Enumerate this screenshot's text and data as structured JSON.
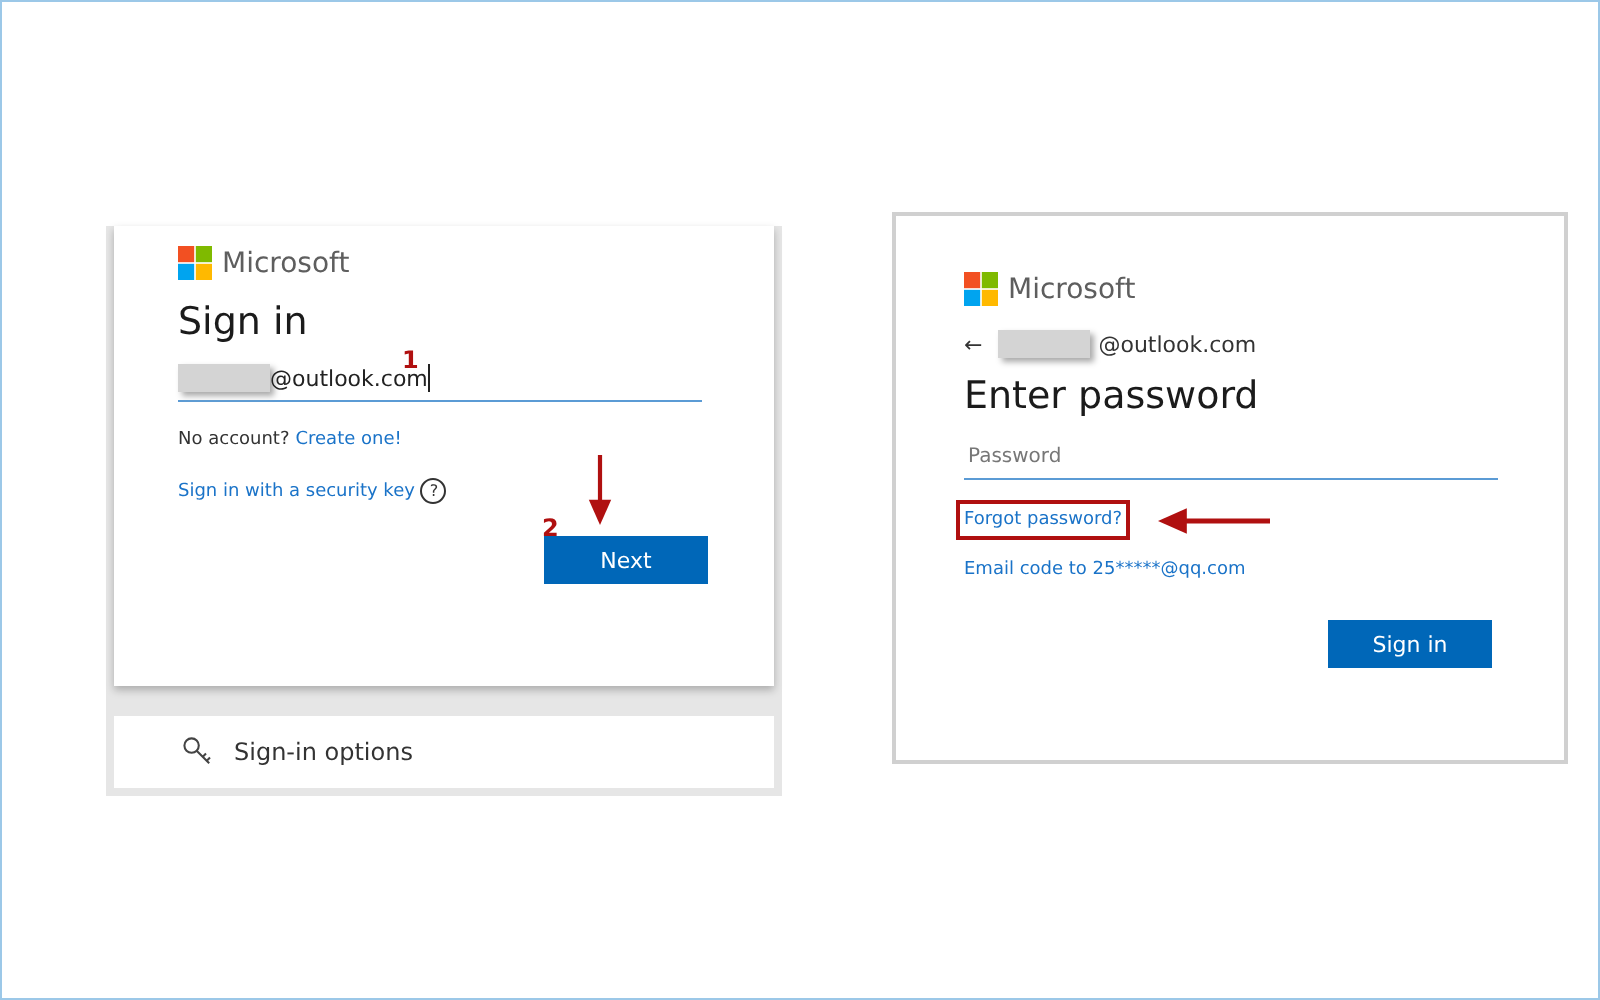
{
  "sign_in_panel": {
    "logo": "Microsoft",
    "title": "Sign in",
    "email_field": {
      "value": "@outlook.com"
    },
    "no_account": "No account?",
    "create_link": "Create one!",
    "security_key_link": "Sign in with a security key",
    "help_glyph": "?",
    "next_button": "Next",
    "options_label": "Sign-in options",
    "step_markers": [
      "1",
      "2"
    ]
  },
  "password_panel": {
    "logo": "Microsoft",
    "back_glyph": "←",
    "account": "@outlook.com",
    "title": "Enter password",
    "password_field": {
      "placeholder": "Password"
    },
    "forgot_link": {
      "text": "Forgot password?",
      "highlighted": true
    },
    "email_code_link": "Email code to 25*****@qq.com",
    "sign_in_button": "Sign in"
  }
}
